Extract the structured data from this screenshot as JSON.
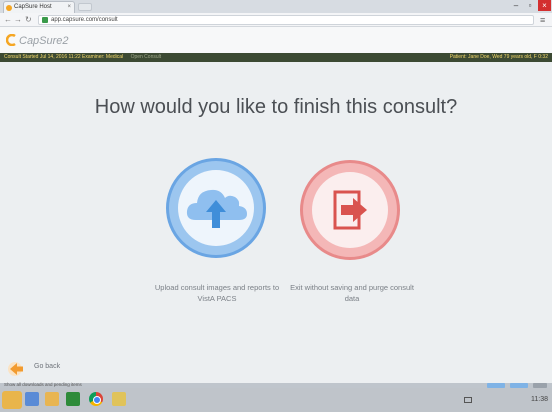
{
  "browser": {
    "tab_title": "CapSure Host",
    "url": "app.capsure.com/consult",
    "window_controls": {
      "minimize": "–",
      "maximize": "▫",
      "close": "×"
    }
  },
  "app": {
    "logo_text": "CapSure2",
    "status_bar": {
      "left_label": "Consult Started Jul 14, 2016 11:22",
      "left_extra": "Examiner: Medical",
      "left_dim": "Open Consult",
      "right": "Patient: Jane Doe, Wed 79 years old, F 0:32"
    }
  },
  "main": {
    "heading": "How would you like to finish this consult?",
    "options": [
      {
        "id": "upload",
        "icon": "cloud-upload-icon",
        "caption": "Upload consult images and reports to VistA PACS"
      },
      {
        "id": "exit",
        "icon": "exit-door-icon",
        "caption": "Exit without saving and purge consult data"
      }
    ],
    "go_back_label": "Go back"
  },
  "colors": {
    "upload_ring": "#6aa5e3",
    "upload_fill": "#9cc6ef",
    "exit_ring": "#e88a8a",
    "exit_fill": "#f4b7b7",
    "arrow_blue": "#3f8ed9",
    "arrow_red": "#d9534f",
    "status_bar_bg": "#3c4a33",
    "status_bar_text": "#f3d86a"
  },
  "bottom": {
    "download_text": "Show all downloads and pending items"
  },
  "taskbar": {
    "tray_text": "11:38"
  }
}
